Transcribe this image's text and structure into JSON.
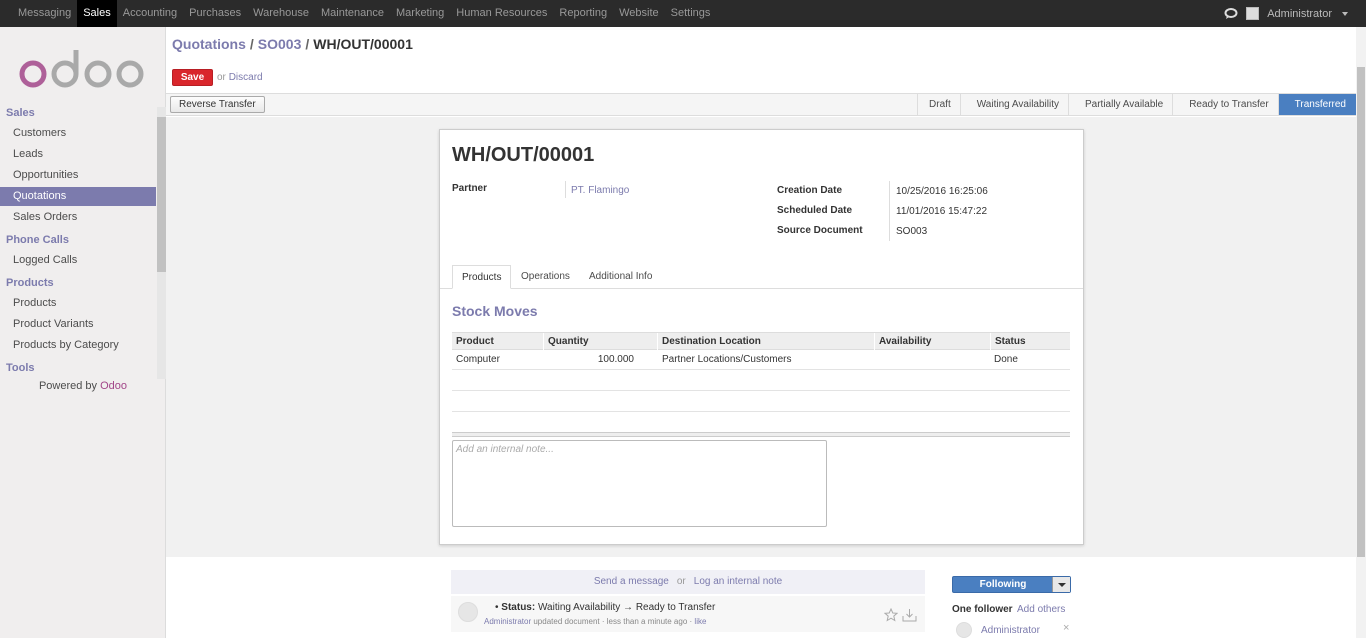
{
  "topbar": {
    "menu": [
      "Messaging",
      "Sales",
      "Accounting",
      "Purchases",
      "Warehouse",
      "Maintenance",
      "Marketing",
      "Human Resources",
      "Reporting",
      "Website",
      "Settings"
    ],
    "active": "Sales",
    "user": "Administrator",
    "chat_icon": "chat-icon"
  },
  "sidebar": {
    "sections": [
      {
        "title": "Sales",
        "items": [
          "Customers",
          "Leads",
          "Opportunities",
          "Quotations",
          "Sales Orders"
        ]
      },
      {
        "title": "Phone Calls",
        "items": [
          "Logged Calls"
        ]
      },
      {
        "title": "Products",
        "items": [
          "Products",
          "Product Variants",
          "Products by Category"
        ]
      },
      {
        "title": "Tools",
        "items": []
      }
    ],
    "active_item": "Quotations",
    "powered_by": "Powered by",
    "powered_brand": "Odoo"
  },
  "breadcrumb": {
    "crumbs": [
      "Quotations",
      "SO003"
    ],
    "current": "WH/OUT/00001",
    "separator": "/"
  },
  "actions": {
    "save": "Save",
    "or": "or",
    "discard": "Discard"
  },
  "statusbar": {
    "reverse_transfer": "Reverse Transfer",
    "stages": [
      "Draft",
      "Waiting Availability",
      "Partially Available",
      "Ready to Transfer",
      "Transferred"
    ],
    "current_stage": "Transferred",
    "current_color": "#4a7fc1"
  },
  "form": {
    "title": "WH/OUT/00001",
    "partner_label": "Partner",
    "partner_value": "PT. Flamingo",
    "creation_date_label": "Creation Date",
    "creation_date_value": "10/25/2016 16:25:06",
    "scheduled_date_label": "Scheduled Date",
    "scheduled_date_value": "11/01/2016 15:47:22",
    "source_document_label": "Source Document",
    "source_document_value": "SO003",
    "tabs": [
      "Products",
      "Operations",
      "Additional Info"
    ],
    "active_tab": "Products",
    "section_title": "Stock Moves",
    "columns": [
      "Product",
      "Quantity",
      "Destination Location",
      "Availability",
      "Status"
    ],
    "rows": [
      {
        "product": "Computer",
        "quantity": "100.000",
        "destination": "Partner Locations/Customers",
        "availability": "",
        "status": "Done"
      }
    ],
    "note_placeholder": "Add an internal note..."
  },
  "chatter": {
    "send_message": "Send a message",
    "or": "or",
    "log_note": "Log an internal note",
    "message": {
      "field_label": "Status:",
      "from_value": "Waiting Availability",
      "to_value": "Ready to Transfer",
      "arrow": "→",
      "bullet": "•",
      "author": "Administrator",
      "action": "updated document",
      "time": "less than a minute ago",
      "dot": "·",
      "like": "like"
    },
    "following": "Following",
    "followers_label": "One follower",
    "add_others": "Add others",
    "follower": "Administrator",
    "remove": "×"
  },
  "colors": {
    "brand": "#7c7bad",
    "save": "#d9262c",
    "topbar": "#2b2b2b"
  }
}
